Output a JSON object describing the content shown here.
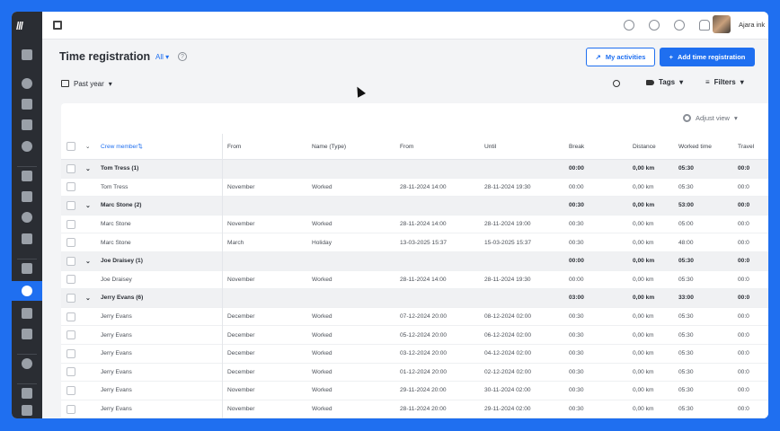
{
  "colors": {
    "brand": "#1f6ff0",
    "sidebar": "#2a2d33",
    "group_bg": "#f0f1f3"
  },
  "sidebar": {
    "logo": "///",
    "items": [
      {
        "icon": "home-icon"
      },
      {
        "icon": "calendar-icon"
      },
      {
        "icon": "user-icon"
      },
      {
        "icon": "chart-icon"
      },
      {
        "icon": "dollar-icon"
      },
      {
        "icon": "boxes-icon"
      },
      {
        "icon": "id-card-icon"
      },
      {
        "icon": "team-icon"
      },
      {
        "icon": "truck-icon"
      },
      {
        "icon": "checklist-icon"
      },
      {
        "icon": "clock-icon",
        "active": true
      },
      {
        "icon": "wrench-icon"
      },
      {
        "icon": "report-icon"
      },
      {
        "icon": "message-icon"
      },
      {
        "icon": "settings-icon"
      },
      {
        "icon": "chevron-up-icon"
      }
    ]
  },
  "topbar": {
    "username": "Ajara ink"
  },
  "page": {
    "title": "Time registration",
    "scope": "All",
    "my_activities": "My activities",
    "add_time": "Add time registration",
    "period": "Past year",
    "tags": "Tags",
    "filters": "Filters",
    "adjust_view": "Adjust view"
  },
  "table": {
    "columns": [
      "Crew member",
      "From",
      "Name (Type)",
      "From",
      "Until",
      "Break",
      "Distance",
      "Worked time",
      "Travel"
    ],
    "rows": [
      {
        "type": "group",
        "name": "Tom Tress (1)",
        "break": "00:00",
        "distance": "0,00 km",
        "worked": "05:30",
        "travel": "00:0"
      },
      {
        "type": "row",
        "name": "Tom Tress",
        "month": "November",
        "kind": "Worked",
        "from": "28-11-2024 14:00",
        "until": "28-11-2024 19:30",
        "break": "00:00",
        "distance": "0,00 km",
        "worked": "05:30",
        "travel": "00:0"
      },
      {
        "type": "group",
        "name": "Marc Stone (2)",
        "break": "00:30",
        "distance": "0,00 km",
        "worked": "53:00",
        "travel": "00:0"
      },
      {
        "type": "row",
        "name": "Marc Stone",
        "month": "November",
        "kind": "Worked",
        "from": "28-11-2024 14:00",
        "until": "28-11-2024 19:00",
        "break": "00:30",
        "distance": "0,00 km",
        "worked": "05:00",
        "travel": "00:0"
      },
      {
        "type": "row",
        "name": "Marc Stone",
        "month": "March",
        "kind": "Holiday",
        "from": "13-03-2025 15:37",
        "until": "15-03-2025 15:37",
        "break": "00:30",
        "distance": "0,00 km",
        "worked": "48:00",
        "travel": "00:0"
      },
      {
        "type": "group",
        "name": "Joe Draisey (1)",
        "break": "00:00",
        "distance": "0,00 km",
        "worked": "05:30",
        "travel": "00:0"
      },
      {
        "type": "row",
        "name": "Joe Draisey",
        "month": "November",
        "kind": "Worked",
        "from": "28-11-2024 14:00",
        "until": "28-11-2024 19:30",
        "break": "00:00",
        "distance": "0,00 km",
        "worked": "05:30",
        "travel": "00:0"
      },
      {
        "type": "group",
        "name": "Jerry Evans (6)",
        "break": "03:00",
        "distance": "0,00 km",
        "worked": "33:00",
        "travel": "00:0"
      },
      {
        "type": "row",
        "name": "Jerry Evans",
        "month": "December",
        "kind": "Worked",
        "from": "07-12-2024 20:00",
        "until": "08-12-2024 02:00",
        "break": "00:30",
        "distance": "0,00 km",
        "worked": "05:30",
        "travel": "00:0"
      },
      {
        "type": "row",
        "name": "Jerry Evans",
        "month": "December",
        "kind": "Worked",
        "from": "05-12-2024 20:00",
        "until": "06-12-2024 02:00",
        "break": "00:30",
        "distance": "0,00 km",
        "worked": "05:30",
        "travel": "00:0"
      },
      {
        "type": "row",
        "name": "Jerry Evans",
        "month": "December",
        "kind": "Worked",
        "from": "03-12-2024 20:00",
        "until": "04-12-2024 02:00",
        "break": "00:30",
        "distance": "0,00 km",
        "worked": "05:30",
        "travel": "00:0"
      },
      {
        "type": "row",
        "name": "Jerry Evans",
        "month": "December",
        "kind": "Worked",
        "from": "01-12-2024 20:00",
        "until": "02-12-2024 02:00",
        "break": "00:30",
        "distance": "0,00 km",
        "worked": "05:30",
        "travel": "00:0"
      },
      {
        "type": "row",
        "name": "Jerry Evans",
        "month": "November",
        "kind": "Worked",
        "from": "29-11-2024 20:00",
        "until": "30-11-2024 02:00",
        "break": "00:30",
        "distance": "0,00 km",
        "worked": "05:30",
        "travel": "00:0"
      },
      {
        "type": "row",
        "name": "Jerry Evans",
        "month": "November",
        "kind": "Worked",
        "from": "28-11-2024 20:00",
        "until": "29-11-2024 02:00",
        "break": "00:30",
        "distance": "0,00 km",
        "worked": "05:30",
        "travel": "00:0"
      }
    ]
  }
}
